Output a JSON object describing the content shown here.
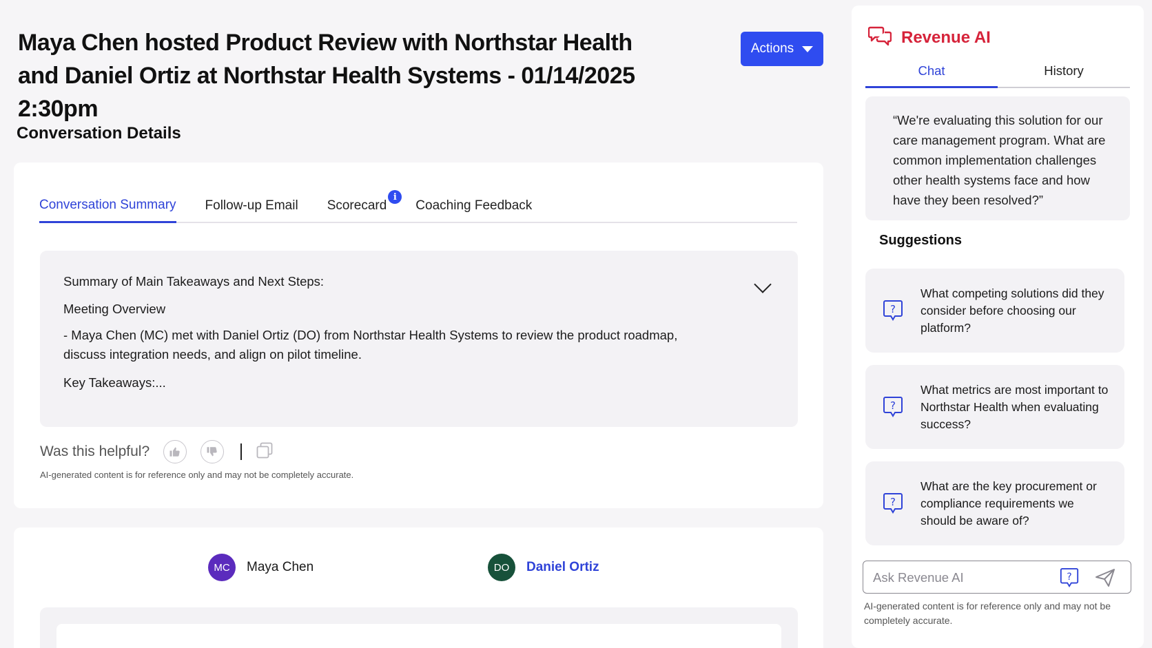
{
  "header": {
    "title_line1": "Maya Chen hosted Product Review with Northstar Health",
    "title_line2": "and Daniel Ortiz at Northstar Health Systems - 01/14/2025 2:30pm",
    "actions_label": "Actions"
  },
  "section_title": "Conversation Details",
  "tabs": [
    {
      "label": "Conversation Summary",
      "active": true
    },
    {
      "label": "Follow-up Email",
      "active": false
    },
    {
      "label": "Scorecard",
      "active": false,
      "info_badge": "i"
    },
    {
      "label": "Coaching Feedback",
      "active": false
    }
  ],
  "summary": {
    "heading": "Summary of Main Takeaways and Next Steps:",
    "overview_label": "Meeting Overview",
    "overview_line1": "- Maya Chen (MC) met with Daniel Ortiz (DO) from Northstar Health Systems to review the product roadmap,",
    "overview_line2": "discuss integration needs, and align on pilot timeline.",
    "key_takeaways": "Key Takeaways:..."
  },
  "feedback": {
    "question": "Was this helpful?",
    "disclaimer": "AI-generated content is for reference only and may not be completely accurate."
  },
  "participants": [
    {
      "initials": "MC",
      "name": "Maya Chen",
      "color": "#5b2bbd"
    },
    {
      "initials": "DO",
      "name": "Daniel Ortiz",
      "color": "#17513a"
    }
  ],
  "sidebar": {
    "title": "Revenue AI",
    "brand_color": "#d6233a",
    "tabs": [
      {
        "label": "Chat",
        "active": true
      },
      {
        "label": "History",
        "active": false
      }
    ],
    "quote": "“We're evaluating this solution for our care management program. What are common implementation challenges other health systems face and how have they been resolved?”",
    "suggestions_title": "Suggestions",
    "suggestions": [
      "What competing solutions did they consider before choosing our platform?",
      "What metrics are most important to Northstar Health when evaluating success?",
      "What are the key procurement or compliance requirements we should be aware of?"
    ],
    "input_placeholder": "Ask Revenue AI",
    "disclaimer": "AI-generated content is for reference only and may not be completely accurate."
  },
  "colors": {
    "accent": "#2f43d8",
    "button": "#2f4cf0"
  }
}
